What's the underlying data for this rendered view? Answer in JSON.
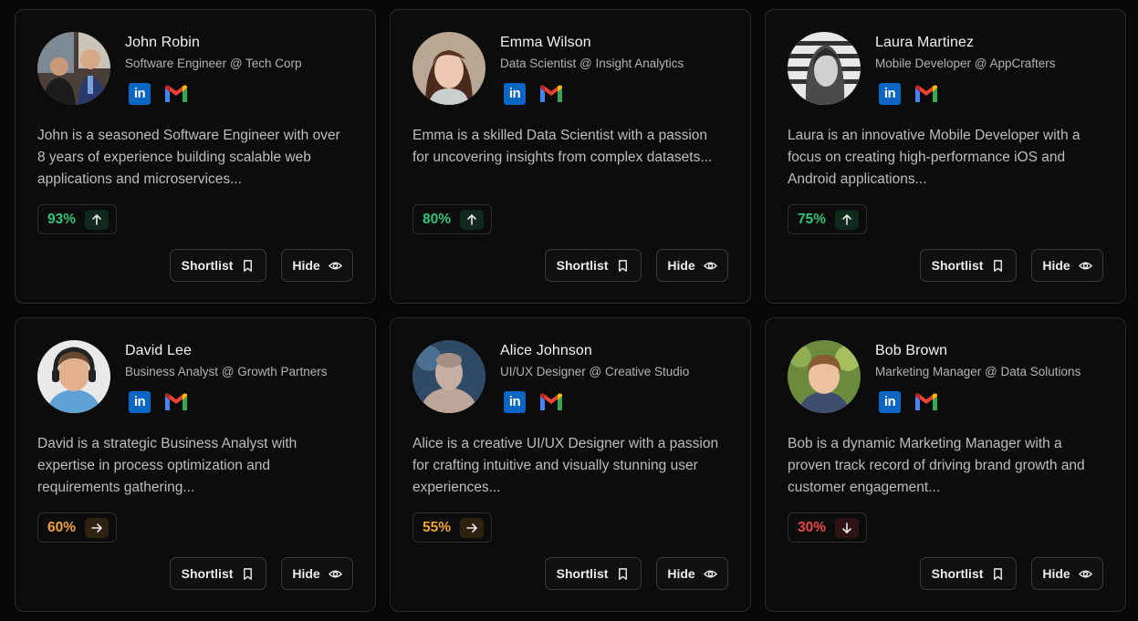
{
  "labels": {
    "shortlist": "Shortlist",
    "hide": "Hide"
  },
  "colors": {
    "up": "#2fc47a",
    "up_bg": "#0f2a1d",
    "neutral": "#f2a431",
    "neutral_bg": "#2e2210",
    "down": "#ef4444",
    "down_bg": "#2e1214"
  },
  "candidates": [
    {
      "name": "John Robin",
      "role": "Software Engineer @ Tech Corp",
      "bio": "John is a seasoned Software Engineer with over 8 years of experience building scalable web applications and microservices...",
      "score": "93%",
      "trend": "up",
      "trend_icon": "arrow-up-icon"
    },
    {
      "name": "Emma Wilson",
      "role": "Data Scientist @ Insight Analytics",
      "bio": "Emma is a skilled Data Scientist with a passion for uncovering insights from complex datasets...",
      "score": "80%",
      "trend": "up",
      "trend_icon": "arrow-up-icon"
    },
    {
      "name": "Laura Martinez",
      "role": "Mobile Developer @ AppCrafters",
      "bio": "Laura is an innovative Mobile Developer with a focus on creating high-performance iOS and Android applications...",
      "score": "75%",
      "trend": "up",
      "trend_icon": "arrow-up-icon"
    },
    {
      "name": "David Lee",
      "role": "Business Analyst @ Growth Partners",
      "bio": "David is a strategic Business Analyst with expertise in process optimization and requirements gathering...",
      "score": "60%",
      "trend": "neutral",
      "trend_icon": "arrow-right-icon"
    },
    {
      "name": "Alice Johnson",
      "role": "UI/UX Designer @ Creative Studio",
      "bio": "Alice is a creative UI/UX Designer with a passion for crafting intuitive and visually stunning user experiences...",
      "score": "55%",
      "trend": "neutral",
      "trend_icon": "arrow-right-icon"
    },
    {
      "name": "Bob Brown",
      "role": "Marketing Manager @ Data Solutions",
      "bio": "Bob is a dynamic Marketing Manager with a proven track record of driving brand growth and customer engagement...",
      "score": "30%",
      "trend": "down",
      "trend_icon": "arrow-down-icon"
    }
  ],
  "icons": {
    "linkedin": "linkedin-icon",
    "gmail": "gmail-icon",
    "bookmark": "bookmark-icon",
    "eye": "eye-icon"
  }
}
